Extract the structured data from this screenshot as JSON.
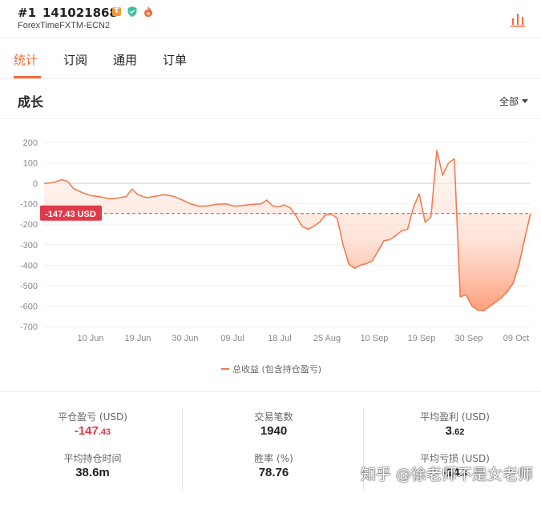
{
  "header": {
    "rank": "#1",
    "account_id": "141021868",
    "badge_t": "T",
    "broker": "ForexTimeFXTM-ECN2"
  },
  "tabs": [
    {
      "label": "统计",
      "active": true
    },
    {
      "label": "订阅",
      "active": false
    },
    {
      "label": "通用",
      "active": false
    },
    {
      "label": "订单",
      "active": false
    }
  ],
  "section": {
    "title": "成长",
    "filter_label": "全部"
  },
  "colors": {
    "accent": "#f26b3a",
    "negative": "#e03a4a",
    "line": "#f47a4f"
  },
  "chart_data": {
    "type": "area",
    "ylim": [
      -700,
      200
    ],
    "y_ticks": [
      200,
      100,
      0,
      -100,
      -200,
      -300,
      -400,
      -500,
      -600,
      -700
    ],
    "x_tick_labels": [
      "10 Jun",
      "19 Jun",
      "30 Jun",
      "09 Jul",
      "18 Jul",
      "25 Aug",
      "10 Sep",
      "19 Sep",
      "30 Sep",
      "09 Oct"
    ],
    "current_value_label": "-147.43 USD",
    "current_value": -147.43,
    "grid": true,
    "legend_position": "bottom-center",
    "series": [
      {
        "name": "总收益 (包含持仓盈亏)",
        "points": [
          [
            0,
            0
          ],
          [
            2,
            2
          ],
          [
            4,
            8
          ],
          [
            6,
            18
          ],
          [
            8,
            10
          ],
          [
            10,
            -25
          ],
          [
            13,
            -45
          ],
          [
            16,
            -60
          ],
          [
            19,
            -65
          ],
          [
            22,
            -75
          ],
          [
            25,
            -72
          ],
          [
            28,
            -65
          ],
          [
            30,
            -28
          ],
          [
            32,
            -55
          ],
          [
            35,
            -70
          ],
          [
            38,
            -63
          ],
          [
            41,
            -55
          ],
          [
            44,
            -62
          ],
          [
            47,
            -80
          ],
          [
            50,
            -100
          ],
          [
            53,
            -112
          ],
          [
            56,
            -110
          ],
          [
            59,
            -102
          ],
          [
            62,
            -100
          ],
          [
            65,
            -112
          ],
          [
            68,
            -108
          ],
          [
            71,
            -103
          ],
          [
            74,
            -100
          ],
          [
            76,
            -82
          ],
          [
            78,
            -110
          ],
          [
            80,
            -115
          ],
          [
            82,
            -105
          ],
          [
            84,
            -120
          ],
          [
            86,
            -160
          ],
          [
            88,
            -210
          ],
          [
            90,
            -225
          ],
          [
            92,
            -210
          ],
          [
            94,
            -190
          ],
          [
            96,
            -155
          ],
          [
            98,
            -150
          ],
          [
            100,
            -170
          ],
          [
            102,
            -300
          ],
          [
            104,
            -395
          ],
          [
            106,
            -415
          ],
          [
            108,
            -400
          ],
          [
            110,
            -392
          ],
          [
            112,
            -380
          ],
          [
            114,
            -330
          ],
          [
            116,
            -280
          ],
          [
            118,
            -275
          ],
          [
            120,
            -255
          ],
          [
            122,
            -232
          ],
          [
            124,
            -225
          ],
          [
            126,
            -120
          ],
          [
            128,
            -50
          ],
          [
            130,
            -190
          ],
          [
            132,
            -165
          ],
          [
            134,
            160
          ],
          [
            136,
            40
          ],
          [
            138,
            100
          ],
          [
            140,
            120
          ],
          [
            142,
            -555
          ],
          [
            144,
            -545
          ],
          [
            146,
            -600
          ],
          [
            148,
            -620
          ],
          [
            150,
            -622
          ],
          [
            152,
            -602
          ],
          [
            154,
            -582
          ],
          [
            156,
            -560
          ],
          [
            158,
            -530
          ],
          [
            160,
            -490
          ],
          [
            162,
            -400
          ],
          [
            164,
            -270
          ],
          [
            166,
            -147.43
          ]
        ]
      }
    ]
  },
  "stats": [
    {
      "label": "平仓盈亏 (USD)",
      "value_main": "-147",
      "value_decimal": ".43",
      "negative": true
    },
    {
      "label": "交易笔数",
      "value_main": "1940",
      "value_decimal": ""
    },
    {
      "label": "平均盈利 (USD)",
      "value_main": "3",
      "value_decimal": ".62"
    },
    {
      "label": "平均持仓时间",
      "value_main": "38.6m",
      "value_decimal": ""
    },
    {
      "label": "胜率 (%)",
      "value_main": "78.76",
      "value_decimal": ""
    },
    {
      "label": "平均亏损 (USD)",
      "value_main": "-14",
      "value_decimal": ".3"
    }
  ],
  "watermark": "知乎 @徐老师不是女老师"
}
